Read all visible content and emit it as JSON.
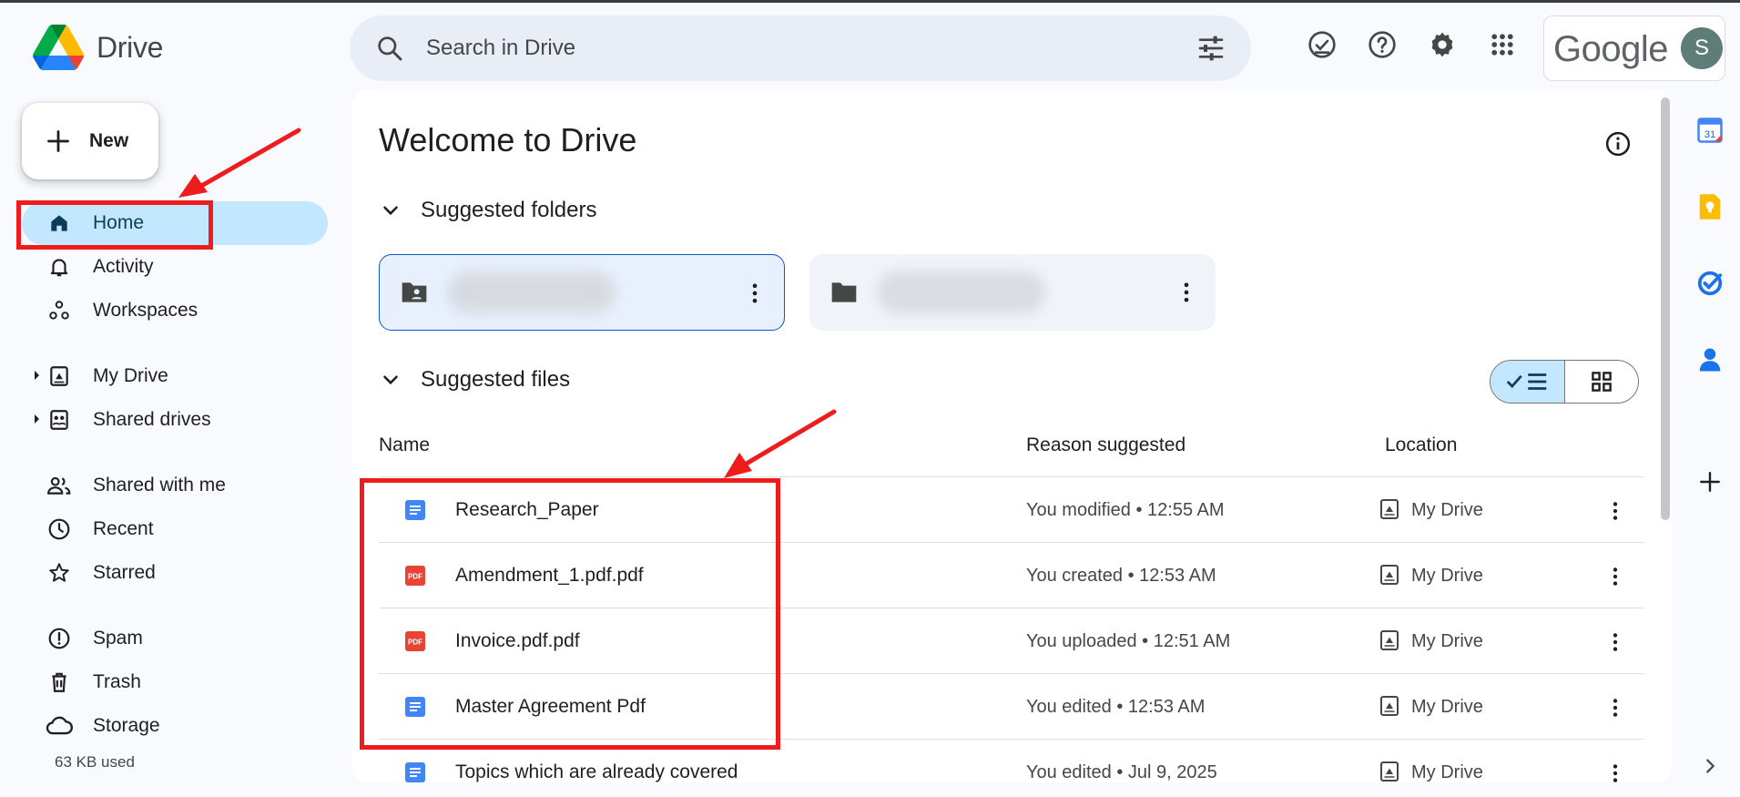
{
  "app": {
    "name": "Drive"
  },
  "search": {
    "placeholder": "Search in Drive"
  },
  "account": {
    "brand": "Google",
    "avatar_initial": "S"
  },
  "sidebar": {
    "new_label": "New",
    "items": [
      {
        "label": "Home",
        "icon": "home-icon",
        "active": true
      },
      {
        "label": "Activity",
        "icon": "bell-icon"
      },
      {
        "label": "Workspaces",
        "icon": "workspaces-icon"
      },
      {
        "label": "My Drive",
        "icon": "my-drive-icon",
        "expandable": true
      },
      {
        "label": "Shared drives",
        "icon": "shared-drives-icon",
        "expandable": true
      },
      {
        "label": "Shared with me",
        "icon": "people-icon"
      },
      {
        "label": "Recent",
        "icon": "clock-icon"
      },
      {
        "label": "Starred",
        "icon": "star-icon"
      },
      {
        "label": "Spam",
        "icon": "spam-icon"
      },
      {
        "label": "Trash",
        "icon": "trash-icon"
      },
      {
        "label": "Storage",
        "icon": "cloud-icon"
      }
    ],
    "storage_used": "63 KB used"
  },
  "main": {
    "title": "Welcome to Drive",
    "suggested_folders_label": "Suggested folders",
    "suggested_files_label": "Suggested files",
    "columns": {
      "name": "Name",
      "reason": "Reason suggested",
      "location": "Location"
    },
    "files": [
      {
        "name": "Research_Paper",
        "type": "doc",
        "reason": "You modified • 12:55 AM",
        "location": "My Drive"
      },
      {
        "name": "Amendment_1.pdf.pdf",
        "type": "pdf",
        "reason": "You created • 12:53 AM",
        "location": "My Drive"
      },
      {
        "name": "Invoice.pdf.pdf",
        "type": "pdf",
        "reason": "You uploaded • 12:51 AM",
        "location": "My Drive"
      },
      {
        "name": "Master Agreement Pdf",
        "type": "doc",
        "reason": "You edited • 12:53 AM",
        "location": "My Drive"
      },
      {
        "name": "Topics which are already covered",
        "type": "doc",
        "reason": "You edited • Jul 9, 2025",
        "location": "My Drive"
      }
    ],
    "pdf_badge": "PDF"
  },
  "side_panel": {
    "calendar_date": "31",
    "apps": [
      "calendar-icon",
      "keep-icon",
      "tasks-icon",
      "contacts-icon",
      "add-icon"
    ]
  },
  "colors": {
    "accent": "#0b57d0",
    "active_nav": "#c2e7ff",
    "annotation": "#ee1c1c",
    "doc_blue": "#4285f4",
    "pdf_red": "#ea4335"
  }
}
